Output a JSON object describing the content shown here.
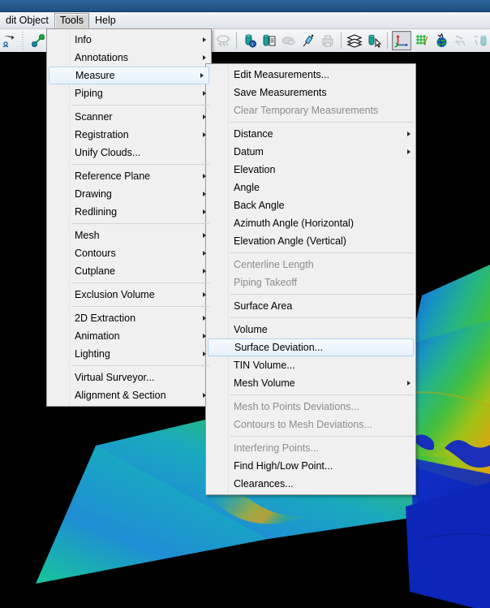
{
  "window": {
    "titlebar_color": "#27598c"
  },
  "menubar": {
    "items": [
      {
        "label": "dit Object",
        "active": false
      },
      {
        "label": "Tools",
        "active": true
      },
      {
        "label": "Help",
        "active": false
      }
    ]
  },
  "toolbar": {
    "buttons": [
      {
        "name": "undo-redo-icon",
        "disabled": false,
        "pressed": false
      },
      {
        "name": "target-pick-icon",
        "disabled": false,
        "pressed": false
      },
      {
        "name": "cloud-hide-icon",
        "disabled": true,
        "pressed": false
      },
      {
        "name": "cloud-show-icon",
        "disabled": true,
        "pressed": false
      },
      {
        "name": "cylinder-info-icon",
        "disabled": false,
        "pressed": false
      },
      {
        "name": "cylinder-list-icon",
        "disabled": false,
        "pressed": false
      },
      {
        "name": "cloud-gray-icon",
        "disabled": true,
        "pressed": false
      },
      {
        "name": "pen-measure-icon",
        "disabled": false,
        "pressed": false
      },
      {
        "name": "print-gray-icon",
        "disabled": true,
        "pressed": false
      },
      {
        "name": "layers-icon",
        "disabled": false,
        "pressed": false
      },
      {
        "name": "cylinder-cursor-icon",
        "disabled": false,
        "pressed": false
      },
      {
        "name": "axis-coordinate-icon",
        "disabled": false,
        "pressed": true
      },
      {
        "name": "grid-green-icon",
        "disabled": false,
        "pressed": false
      },
      {
        "name": "globe-icon",
        "disabled": false,
        "pressed": false
      },
      {
        "name": "scan-gray-icon",
        "disabled": true,
        "pressed": false
      },
      {
        "name": "scan-cylinder-icon",
        "disabled": true,
        "pressed": false
      }
    ]
  },
  "tools_menu": {
    "name": "Tools",
    "items": [
      {
        "label": "Info",
        "submenu": true,
        "disabled": false,
        "highlighted": false
      },
      {
        "label": "Annotations",
        "submenu": true,
        "disabled": false,
        "highlighted": false
      },
      {
        "label": "Measure",
        "submenu": true,
        "disabled": false,
        "highlighted": true
      },
      {
        "label": "Piping",
        "submenu": true,
        "disabled": false,
        "highlighted": false
      },
      {
        "separator": true
      },
      {
        "label": "Scanner",
        "submenu": true,
        "disabled": false,
        "highlighted": false
      },
      {
        "label": "Registration",
        "submenu": true,
        "disabled": false,
        "highlighted": false
      },
      {
        "label": "Unify Clouds...",
        "submenu": false,
        "disabled": false,
        "highlighted": false
      },
      {
        "separator": true
      },
      {
        "label": "Reference Plane",
        "submenu": true,
        "disabled": false,
        "highlighted": false
      },
      {
        "label": "Drawing",
        "submenu": true,
        "disabled": false,
        "highlighted": false
      },
      {
        "label": "Redlining",
        "submenu": true,
        "disabled": false,
        "highlighted": false
      },
      {
        "separator": true
      },
      {
        "label": "Mesh",
        "submenu": true,
        "disabled": false,
        "highlighted": false
      },
      {
        "label": "Contours",
        "submenu": true,
        "disabled": false,
        "highlighted": false
      },
      {
        "label": "Cutplane",
        "submenu": true,
        "disabled": false,
        "highlighted": false
      },
      {
        "separator": true
      },
      {
        "label": "Exclusion Volume",
        "submenu": true,
        "disabled": false,
        "highlighted": false
      },
      {
        "separator": true
      },
      {
        "label": "2D Extraction",
        "submenu": true,
        "disabled": false,
        "highlighted": false
      },
      {
        "label": "Animation",
        "submenu": true,
        "disabled": false,
        "highlighted": false
      },
      {
        "label": "Lighting",
        "submenu": true,
        "disabled": false,
        "highlighted": false
      },
      {
        "separator": true
      },
      {
        "label": "Virtual Surveyor...",
        "submenu": false,
        "disabled": false,
        "highlighted": false
      },
      {
        "label": "Alignment & Section",
        "submenu": true,
        "disabled": false,
        "highlighted": false
      }
    ]
  },
  "measure_menu": {
    "name": "Measure",
    "items": [
      {
        "label": "Edit Measurements...",
        "submenu": false,
        "disabled": false,
        "highlighted": false
      },
      {
        "label": "Save Measurements",
        "submenu": false,
        "disabled": false,
        "highlighted": false
      },
      {
        "label": "Clear Temporary Measurements",
        "submenu": false,
        "disabled": true,
        "highlighted": false
      },
      {
        "separator": true
      },
      {
        "label": "Distance",
        "submenu": true,
        "disabled": false,
        "highlighted": false
      },
      {
        "label": "Datum",
        "submenu": true,
        "disabled": false,
        "highlighted": false
      },
      {
        "label": "Elevation",
        "submenu": false,
        "disabled": false,
        "highlighted": false
      },
      {
        "label": "Angle",
        "submenu": false,
        "disabled": false,
        "highlighted": false
      },
      {
        "label": "Back Angle",
        "submenu": false,
        "disabled": false,
        "highlighted": false
      },
      {
        "label": "Azimuth Angle (Horizontal)",
        "submenu": false,
        "disabled": false,
        "highlighted": false
      },
      {
        "label": "Elevation Angle (Vertical)",
        "submenu": false,
        "disabled": false,
        "highlighted": false
      },
      {
        "separator": true
      },
      {
        "label": "Centerline Length",
        "submenu": false,
        "disabled": true,
        "highlighted": false
      },
      {
        "label": "Piping Takeoff",
        "submenu": false,
        "disabled": true,
        "highlighted": false
      },
      {
        "separator": true
      },
      {
        "label": "Surface Area",
        "submenu": false,
        "disabled": false,
        "highlighted": false
      },
      {
        "separator": true
      },
      {
        "label": "Volume",
        "submenu": false,
        "disabled": false,
        "highlighted": false
      },
      {
        "label": "Surface Deviation...",
        "submenu": false,
        "disabled": false,
        "highlighted": true
      },
      {
        "label": "TIN Volume...",
        "submenu": false,
        "disabled": false,
        "highlighted": false
      },
      {
        "label": "Mesh Volume",
        "submenu": true,
        "disabled": false,
        "highlighted": false
      },
      {
        "separator": true
      },
      {
        "label": "Mesh to Points Deviations...",
        "submenu": false,
        "disabled": true,
        "highlighted": false
      },
      {
        "label": "Contours to Mesh Deviations...",
        "submenu": false,
        "disabled": true,
        "highlighted": false
      },
      {
        "separator": true
      },
      {
        "label": "Interfering Points...",
        "submenu": false,
        "disabled": true,
        "highlighted": false
      },
      {
        "label": "Find High/Low Point...",
        "submenu": false,
        "disabled": false,
        "highlighted": false
      },
      {
        "label": "Clearances...",
        "submenu": false,
        "disabled": false,
        "highlighted": false
      }
    ]
  },
  "viewport": {
    "name": "3d-terrain-view",
    "background_color": "#000000",
    "description": "Colorized point-cloud / mesh terrain surfaces rendered on black background",
    "surface_colors": [
      "#0b2fd0",
      "#1f8fd6",
      "#18c79a",
      "#3fc04a",
      "#8fc41f",
      "#d8b611",
      "#e08a10"
    ]
  }
}
